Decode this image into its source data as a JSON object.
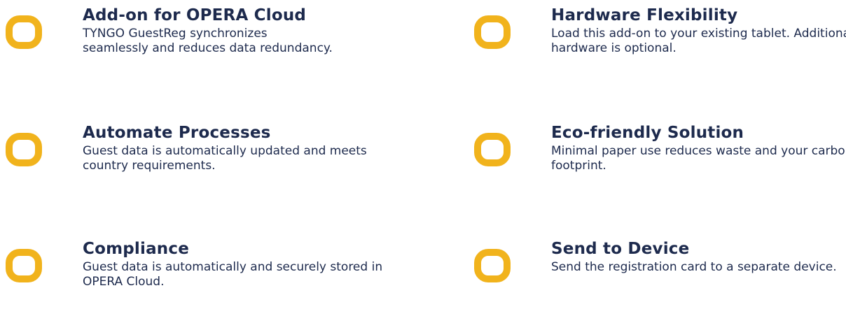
{
  "features": [
    {
      "icon": "ring-icon",
      "title": "Add-on for OPERA Cloud",
      "description": "TYNGO GuestReg synchronizes seamlessly and reduces data redundancy."
    },
    {
      "icon": "ring-icon",
      "title": "Hardware Flexibility",
      "description": "Load this add-on to your existing tablet. Additional hardware is optional."
    },
    {
      "icon": "ring-icon",
      "title": "Automate Processes",
      "description": "Guest data is automatically updated and meets country requirements."
    },
    {
      "icon": "ring-icon",
      "title": "Eco-friendly Solution",
      "description": "Minimal paper use reduces waste and your carbon footprint."
    },
    {
      "icon": "ring-icon",
      "title": "Compliance",
      "description": "Guest data is automatically and securely stored in OPERA Cloud."
    },
    {
      "icon": "ring-icon",
      "title": "Send to Device",
      "description": "Send the registration card to a separate device."
    }
  ],
  "colors": {
    "accent": "#f1b31c",
    "text": "#1d2a4d"
  }
}
